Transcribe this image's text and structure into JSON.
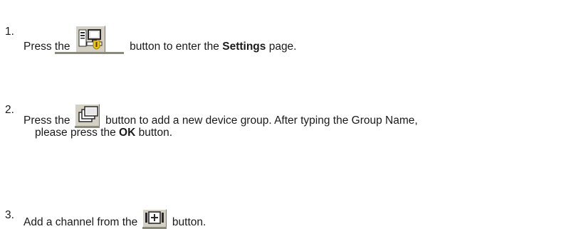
{
  "steps": [
    {
      "number": "1.",
      "before": "Press the",
      "icon": "settings-icon",
      "after_a": "button to enter the ",
      "bold": "Settings",
      "after_b": " page."
    },
    {
      "number": "2.",
      "before": "Press the",
      "icon": "add-group-icon",
      "after_a": "button to add a new device group. After typing the Group Name,",
      "cont_a": "please press the ",
      "bold": "OK",
      "cont_b": " button."
    },
    {
      "number": "3.",
      "before": "Add a channel from the",
      "icon": "add-channel-icon",
      "after_a": "button."
    }
  ],
  "colors": {
    "text": "#1a1a1a",
    "button_face": "#d4d0c4",
    "icon_yellow": "#f2c400",
    "icon_dark": "#3a3a3a"
  }
}
